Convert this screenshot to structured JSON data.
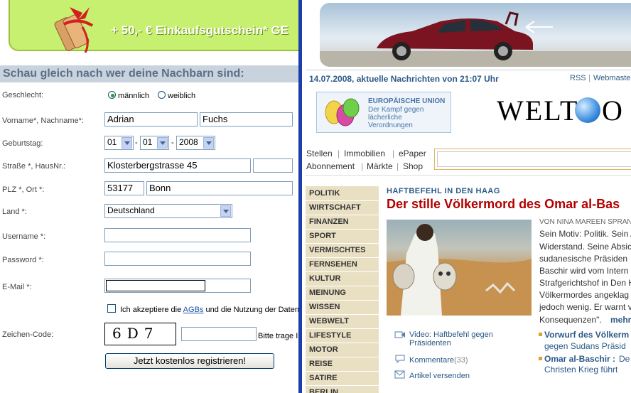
{
  "left": {
    "promo_text": "+ 50,- € Einkaufsgutschein* GE",
    "heading": "Schau gleich nach wer deine Nachbarn sind:",
    "fields": {
      "gender_label": "Geschlecht:",
      "gender_male": "männlich",
      "gender_female": "weiblich",
      "name_label": "Vorname*, Nachname*:",
      "firstname": "Adrian",
      "lastname": "Fuchs",
      "birthday_label": "Geburtstag:",
      "day": "01",
      "month": "01",
      "year": "2008",
      "date_sep": "-",
      "street_label": "Straße *, HausNr.:",
      "street": "Klosterbergstrasse 45",
      "house_no": "",
      "zip_label": "PLZ *, Ort *:",
      "zip": "53177",
      "city": "Bonn",
      "country_label": "Land *:",
      "country": "Deutschland",
      "username_label": "Username *:",
      "username": "",
      "password_label": "Password *:",
      "password": "",
      "email_label": "E-Mail *:",
      "email": "",
      "terms_pre": "Ich akzeptiere die",
      "terms_link": "AGBs",
      "terms_post": "und die Nutzung der Datend",
      "captcha_label": "Zeichen-Code:",
      "captcha_text": "6D7",
      "captcha_input": "",
      "captcha_hint": "Bitte trage I",
      "submit": "Jetzt kostenlos registrieren!"
    }
  },
  "right": {
    "date_line": "14.07.2008,  aktuelle Nachrichten von 21:07 Uhr",
    "rss": "RSS",
    "webmaster": "Webmaster",
    "eu": {
      "title": "EUROPÄISCHE UNION",
      "lines": [
        "Der Kampf gegen",
        "lächerliche",
        "Verordnungen"
      ]
    },
    "logo_left": "WELT",
    "logo_right": "O",
    "toplinks_row1": [
      "Stellen",
      "Immobilien",
      "ePaper"
    ],
    "toplinks_row2": [
      "Abonnement",
      "Märkte",
      "Shop"
    ],
    "link_sep": "|",
    "nav": [
      "POLITIK",
      "WIRTSCHAFT",
      "FINANZEN",
      "SPORT",
      "VERMISCHTES",
      "FERNSEHEN",
      "KULTUR",
      "MEINUNG",
      "WISSEN",
      "WEBWELT",
      "LIFESTYLE",
      "MOTOR",
      "REISE",
      "SATIRE",
      "BERLIN"
    ],
    "article": {
      "kicker": "HAFTBEFEHL IN DEN HAAG",
      "headline": "Der stille Völkermord des Omar al-Bas",
      "byline": "VON NINA MAREEN SPRAN",
      "body": [
        "Sein Motiv: Politik. Sein A",
        "Widerstand. Seine Absic",
        "sudanesische Präsiden",
        "Baschir wird vom Intern",
        "Strafgerichtshof in Den H",
        "Völkermordes angeklag",
        "jedoch wenig. Er warnt v",
        "Konsequenzen\"."
      ],
      "more": "mehr",
      "video": "Video: Haftbefehl gegen Präsidenten",
      "comments": "Kommentare",
      "comments_count": "(33)",
      "send": "Artikel versenden",
      "related": [
        {
          "bold": "Vorwurf des Völkerm",
          "normal": "gegen Sudans Präsid"
        },
        {
          "bold": "Omar al-Baschir :",
          "normal_inline": "De",
          "normal": "Christen Krieg führt"
        }
      ]
    }
  }
}
